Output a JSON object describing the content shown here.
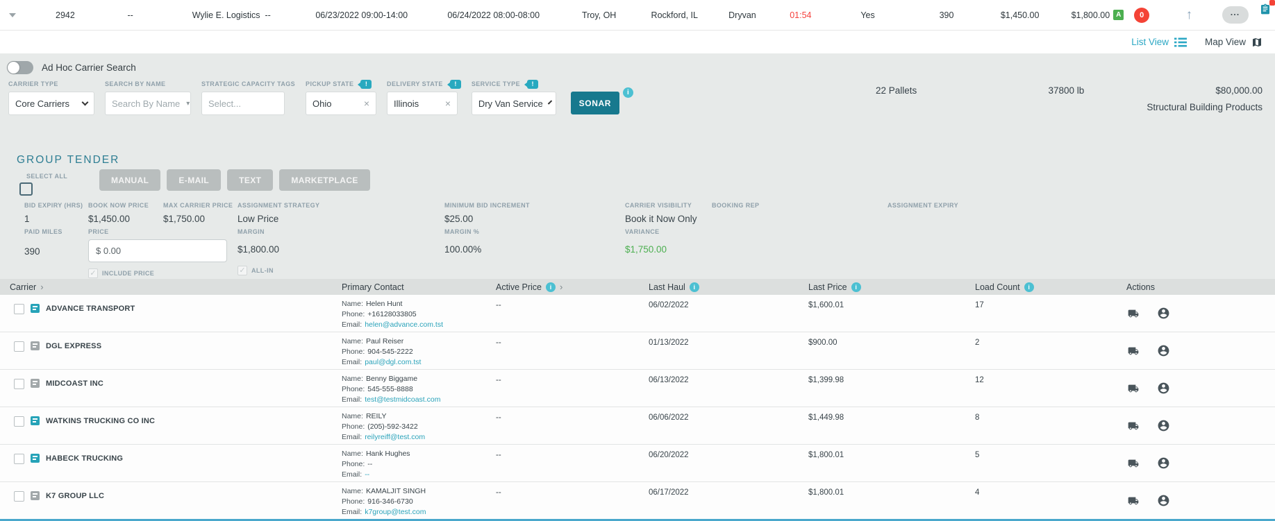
{
  "colors": {
    "accent_teal": "#17798e",
    "info_teal": "#4cc0d2",
    "link_teal": "#2aa3ba",
    "alert_red": "#f44336",
    "success_green": "#4caf50",
    "carrier_icon_teal": "#26a3b8",
    "carrier_icon_gray": "#a2a8aa"
  },
  "topbar": {
    "load_number": "2942",
    "ref_dash": "--",
    "customer": "Wylie E. Logistics",
    "customer_dash": "--",
    "pickup_window": "06/23/2022 09:00-14:00",
    "delivery_window": "06/24/2022 08:00-08:00",
    "origin": "Troy, OH",
    "destination": "Rockford, IL",
    "equipment": "Dryvan",
    "timer": "01:54",
    "tendered": "Yes",
    "miles": "390",
    "price_low": "$1,450.00",
    "price_high": "$1,800.00",
    "badge_a": "A",
    "badge_zero": "0",
    "up_arrow": "↑",
    "more_label": "..."
  },
  "viewbar": {
    "list_view": "List View",
    "map_view": "Map View"
  },
  "adhoc": {
    "label": "Ad Hoc Carrier Search"
  },
  "filters": {
    "carrier_type": {
      "label": "CARRIER TYPE",
      "value": "Core Carriers"
    },
    "search_by_name": {
      "label": "SEARCH BY NAME",
      "placeholder": "Search By Name"
    },
    "capacity_tags": {
      "label": "STRATEGIC CAPACITY TAGS",
      "placeholder": "Select..."
    },
    "pickup_state": {
      "label": "PICKUP STATE",
      "value": "Ohio"
    },
    "delivery_state": {
      "label": "DELIVERY STATE",
      "value": "Illinois"
    },
    "service_type": {
      "label": "SERVICE TYPE",
      "value": "Dry Van Service"
    },
    "sonar_label": "SONAR",
    "clear_x": "×"
  },
  "shipment": {
    "pallets": "22 Pallets",
    "weight": "37800 lb",
    "value": "$80,000.00",
    "commodity": "Structural Building Products"
  },
  "group_tender": {
    "title": "GROUP TENDER",
    "select_all": "SELECT ALL",
    "buttons": {
      "manual": "MANUAL",
      "email": "E-MAIL",
      "text": "TEXT",
      "marketplace": "MARKETPLACE"
    },
    "bid_expiry": {
      "label": "BID EXPIRY (HRS)",
      "value": "1"
    },
    "book_now_price": {
      "label": "BOOK NOW PRICE",
      "value": "$1,450.00"
    },
    "max_carrier_price": {
      "label": "MAX CARRIER PRICE",
      "value": "$1,750.00"
    },
    "assignment_strategy": {
      "label": "ASSIGNMENT STRATEGY",
      "value": "Low Price"
    },
    "minimum_bid_increment": {
      "label": "MINIMUM BID INCREMENT",
      "value": "$25.00"
    },
    "carrier_visibility": {
      "label": "CARRIER VISIBILITY",
      "value": "Book it Now Only"
    },
    "booking_rep": {
      "label": "BOOKING REP",
      "value": ""
    },
    "assignment_expiry": {
      "label": "ASSIGNMENT EXPIRY",
      "value": ""
    },
    "paid_miles": {
      "label": "PAID MILES",
      "value": "390"
    },
    "price": {
      "label": "PRICE",
      "value": "$ 0.00",
      "checkbox_label": "INCLUDE PRICE",
      "check": "✓"
    },
    "margin": {
      "label": "MARGIN",
      "value": "$1,800.00",
      "checkbox_label": "ALL-IN",
      "check": "✓"
    },
    "margin_pct": {
      "label": "MARGIN %",
      "value": "100.00%"
    },
    "variance": {
      "label": "VARIANCE",
      "value": "$1,750.00"
    }
  },
  "table": {
    "headers": {
      "carrier": "Carrier",
      "primary_contact": "Primary Contact",
      "active_price": "Active Price",
      "last_haul": "Last Haul",
      "last_price": "Last Price",
      "load_count": "Load Count",
      "actions": "Actions",
      "sort_arrow": "›",
      "info": "i"
    },
    "contact_labels": {
      "name": "Name:",
      "phone": "Phone:",
      "email": "Email:"
    },
    "rows": [
      {
        "name": "ADVANCE TRANSPORT",
        "icon_class": "cicon teal",
        "contact_name": "Helen Hunt",
        "phone": "+16128033805",
        "email": "helen@advance.com.tst",
        "active_price": "--",
        "last_haul": "06/02/2022",
        "last_price": "$1,600.01",
        "load_count": "17"
      },
      {
        "name": "DGL EXPRESS",
        "icon_class": "cicon gray",
        "contact_name": "Paul Reiser",
        "phone": "904-545-2222",
        "email": "paul@dgl.com.tst",
        "active_price": "--",
        "last_haul": "01/13/2022",
        "last_price": "$900.00",
        "load_count": "2"
      },
      {
        "name": "MIDCOAST INC",
        "icon_class": "cicon gray",
        "contact_name": "Benny Biggame",
        "phone": "545-555-8888",
        "email": "test@testmidcoast.com",
        "active_price": "--",
        "last_haul": "06/13/2022",
        "last_price": "$1,399.98",
        "load_count": "12"
      },
      {
        "name": "WATKINS TRUCKING CO INC",
        "icon_class": "cicon teal",
        "contact_name": "REILY",
        "phone": "(205)-592-3422",
        "email": "reilyreiff@test.com",
        "active_price": "--",
        "last_haul": "06/06/2022",
        "last_price": "$1,449.98",
        "load_count": "8"
      },
      {
        "name": "HABECK TRUCKING",
        "icon_class": "cicon teal",
        "contact_name": "Hank Hughes",
        "phone": "--",
        "email": "--",
        "active_price": "--",
        "last_haul": "06/20/2022",
        "last_price": "$1,800.01",
        "load_count": "5"
      },
      {
        "name": "K7 GROUP LLC",
        "icon_class": "cicon gray",
        "contact_name": "KAMALJIT SINGH",
        "phone": "916-346-6730",
        "email": "k7group@test.com",
        "active_price": "--",
        "last_haul": "06/17/2022",
        "last_price": "$1,800.01",
        "load_count": "4"
      }
    ]
  }
}
